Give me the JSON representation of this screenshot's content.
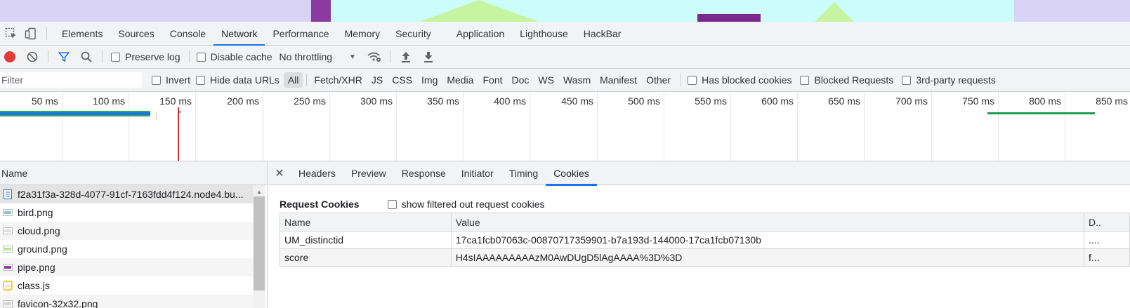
{
  "main_tabs": [
    "Elements",
    "Sources",
    "Console",
    "Network",
    "Performance",
    "Memory",
    "Security",
    "Application",
    "Lighthouse",
    "HackBar"
  ],
  "toolbar": {
    "preserve_log": "Preserve log",
    "disable_cache": "Disable cache",
    "throttling": "No throttling"
  },
  "filter": {
    "placeholder": "Filter",
    "invert": "Invert",
    "hide_data_urls": "Hide data URLs",
    "types": [
      "All",
      "Fetch/XHR",
      "JS",
      "CSS",
      "Img",
      "Media",
      "Font",
      "Doc",
      "WS",
      "Wasm",
      "Manifest",
      "Other"
    ],
    "has_blocked_cookies": "Has blocked cookies",
    "blocked_requests": "Blocked Requests",
    "third_party": "3rd-party requests"
  },
  "timeline": {
    "labels": [
      "50 ms",
      "100 ms",
      "150 ms",
      "200 ms",
      "250 ms",
      "300 ms",
      "350 ms",
      "400 ms",
      "450 ms",
      "500 ms",
      "550 ms",
      "600 ms",
      "650 ms",
      "700 ms",
      "750 ms",
      "800 ms",
      "850 ms"
    ]
  },
  "requests": {
    "header": "Name",
    "items": [
      {
        "name": "f2a31f3a-328d-4077-91cf-7163fdd4f124.node4.bu...",
        "icon": "document-icon"
      },
      {
        "name": "bird.png",
        "icon": "image-icon"
      },
      {
        "name": "cloud.png",
        "icon": "image-icon"
      },
      {
        "name": "ground.png",
        "icon": "image-icon"
      },
      {
        "name": "pipe.png",
        "icon": "image-icon"
      },
      {
        "name": "class.js",
        "icon": "script-icon"
      },
      {
        "name": "favicon-32x32.png",
        "icon": "image-icon"
      }
    ]
  },
  "detail_tabs": [
    "Headers",
    "Preview",
    "Response",
    "Initiator",
    "Timing",
    "Cookies"
  ],
  "cookies": {
    "title": "Request Cookies",
    "show_filtered": "show filtered out request cookies",
    "columns": [
      "Name",
      "Value",
      "D.."
    ],
    "rows": [
      {
        "name": "UM_distinctid",
        "value": "17ca1fcb07063c-00870717359901-b7a193d-144000-17ca1fcb07130b",
        "d": "...."
      },
      {
        "name": "score",
        "value": "H4sIAAAAAAAAAzM0AwDUgD5lAgAAAA%3D%3D",
        "d": "f..."
      }
    ]
  },
  "colors": {
    "accent": "#1a73e8",
    "record": "#e53935",
    "filter_active": "#1a73e8"
  }
}
